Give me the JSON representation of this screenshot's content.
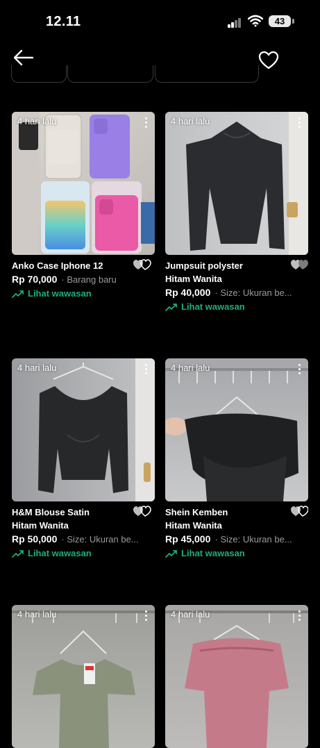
{
  "status_bar": {
    "time": "12.11",
    "battery": "43"
  },
  "listings": [
    {
      "age": "4 hari lalu",
      "title_l1": "Anko Case Iphone 12",
      "title_l2": "",
      "price": "Rp 70,000",
      "note": "· Barang baru",
      "insight": "Lihat wawasan"
    },
    {
      "age": "4 hari lalu",
      "title_l1": "Jumpsuit polyster",
      "title_l2": "Hitam Wanita",
      "price": "Rp 40,000",
      "note": "· Size: Ukuran be...",
      "insight": "Lihat wawasan"
    },
    {
      "age": "4 hari lalu",
      "title_l1": "H&M Blouse Satin",
      "title_l2": "Hitam Wanita",
      "price": "Rp 50,000",
      "note": "· Size: Ukuran be...",
      "insight": "Lihat wawasan"
    },
    {
      "age": "4 hari lalu",
      "title_l1": "Shein Kemben",
      "title_l2": "Hitam Wanita",
      "price": "Rp 45,000",
      "note": "· Size: Ukuran be...",
      "insight": "Lihat wawasan"
    },
    {
      "age": "4 hari lalu"
    },
    {
      "age": "4 hari lalu"
    }
  ],
  "colors": {
    "background": "#000000",
    "insight": "#1fae7a",
    "muted": "#9a9a9a"
  },
  "icons": [
    "back-arrow-icon",
    "heart-icon",
    "kebab-icon",
    "trend-icon",
    "signal-icon",
    "wifi-icon",
    "battery-icon"
  ]
}
